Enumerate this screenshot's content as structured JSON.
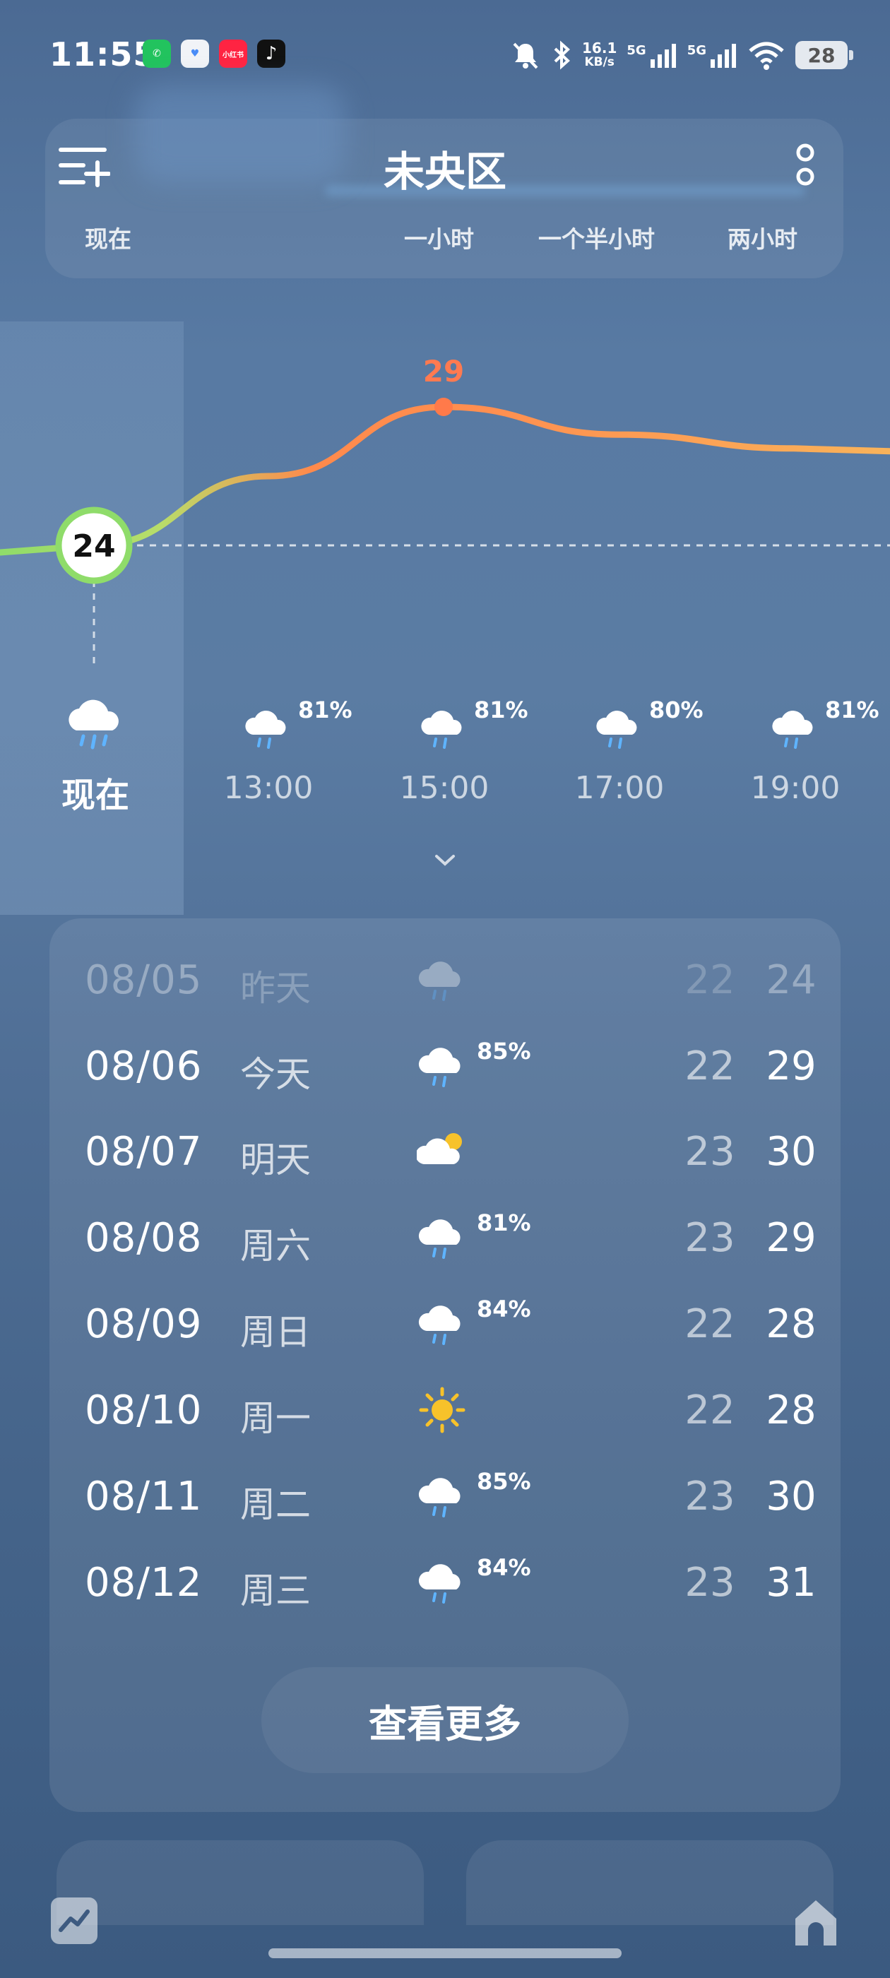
{
  "status_bar": {
    "time": "11:55",
    "apps": [
      {
        "name": "wechat",
        "color": "#22c35e",
        "glyph": "✆"
      },
      {
        "name": "health",
        "color": "#f1f3f7",
        "glyph": "♥"
      },
      {
        "name": "xiaohongshu",
        "color": "#ff2442",
        "glyph": "小红书"
      },
      {
        "name": "tiktok",
        "color": "#111111",
        "glyph": "♪"
      }
    ],
    "net_speed_value": "16.1",
    "net_speed_unit": "KB/s",
    "signal1_label": "5G",
    "signal2_label": "5G",
    "battery": "28"
  },
  "header": {
    "city": "未央区",
    "tabs": [
      "现在",
      "一小时",
      "一个半小时",
      "两小时"
    ]
  },
  "chart_data": {
    "type": "line",
    "title": "",
    "x": [
      "现在",
      "13:00",
      "15:00",
      "17:00",
      "19:00"
    ],
    "series": [
      {
        "values": [
          24,
          26.5,
          29,
          28,
          27.5
        ]
      }
    ],
    "highlight_current": "24",
    "highlight_max": "29",
    "ylim": [
      22,
      31
    ]
  },
  "hourly": {
    "now_label": "现在",
    "items": [
      {
        "time": "13:00",
        "pop": "81%"
      },
      {
        "time": "15:00",
        "pop": "81%"
      },
      {
        "time": "17:00",
        "pop": "80%"
      },
      {
        "time": "19:00",
        "pop": "81%"
      }
    ]
  },
  "daily": {
    "rows": [
      {
        "date": "08/05",
        "day": "昨天",
        "icon": "rain-cloud-icon",
        "pop": "",
        "low": "22",
        "high": "24",
        "dim": true
      },
      {
        "date": "08/06",
        "day": "今天",
        "icon": "rain-cloud-icon",
        "pop": "85%",
        "low": "22",
        "high": "29",
        "dim": false
      },
      {
        "date": "08/07",
        "day": "明天",
        "icon": "partly-cloudy-icon",
        "pop": "",
        "low": "23",
        "high": "30",
        "dim": false
      },
      {
        "date": "08/08",
        "day": "周六",
        "icon": "rain-cloud-icon",
        "pop": "81%",
        "low": "23",
        "high": "29",
        "dim": false
      },
      {
        "date": "08/09",
        "day": "周日",
        "icon": "rain-cloud-icon",
        "pop": "84%",
        "low": "22",
        "high": "28",
        "dim": false
      },
      {
        "date": "08/10",
        "day": "周一",
        "icon": "sun-icon",
        "pop": "",
        "low": "22",
        "high": "28",
        "dim": false
      },
      {
        "date": "08/11",
        "day": "周二",
        "icon": "rain-cloud-icon",
        "pop": "85%",
        "low": "23",
        "high": "30",
        "dim": false
      },
      {
        "date": "08/12",
        "day": "周三",
        "icon": "rain-cloud-icon",
        "pop": "84%",
        "low": "23",
        "high": "31",
        "dim": false
      }
    ],
    "more_label": "查看更多"
  },
  "colors": {
    "temp_low": "#8fdc6a",
    "temp_mid": "#f7a85a",
    "temp_high": "#ff7a4a",
    "max_label": "#ff7a50"
  }
}
